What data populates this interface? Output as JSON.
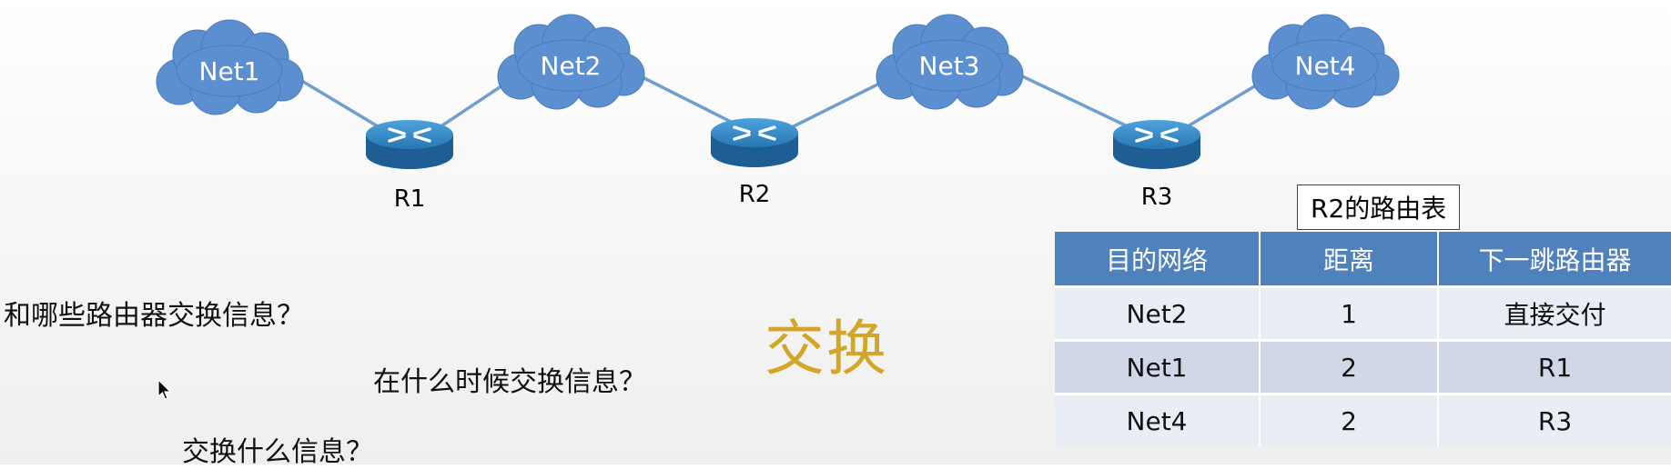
{
  "diagram": {
    "networks": [
      "Net1",
      "Net2",
      "Net3",
      "Net4"
    ],
    "routers": [
      "R1",
      "R2",
      "R3"
    ]
  },
  "questions": [
    "和哪些路由器交换信息？",
    "在什么时候交换信息？",
    "交换什么信息？"
  ],
  "highlight_word": "交换",
  "routing_table": {
    "caption": "R2的路由表",
    "headers": [
      "目的网络",
      "距离",
      "下一跳路由器"
    ],
    "rows": [
      [
        "Net2",
        "1",
        "直接交付"
      ],
      [
        "Net1",
        "2",
        "R1"
      ],
      [
        "Net4",
        "2",
        "R3"
      ]
    ]
  },
  "colors": {
    "cloud": "#5b8fd0",
    "router": "#2e7fbd",
    "link": "#6f9fce",
    "table_header": "#4f81bd",
    "highlight": "#d4a628"
  }
}
